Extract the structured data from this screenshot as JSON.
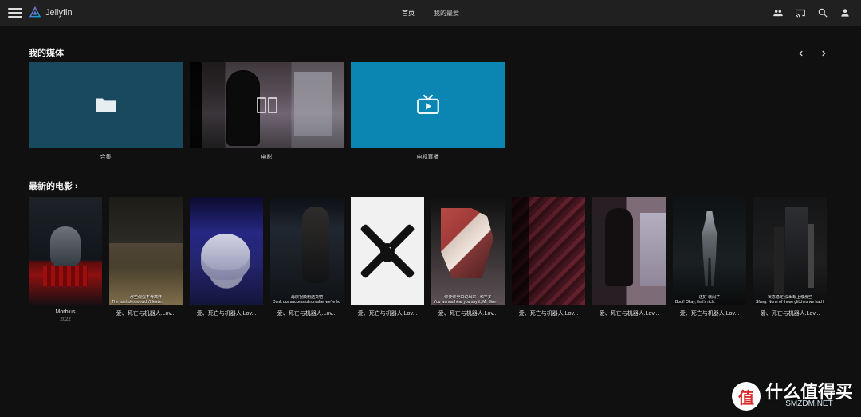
{
  "app": {
    "name": "Jellyfin"
  },
  "nav": {
    "tabs": [
      {
        "label": "首页"
      },
      {
        "label": "我的最爱"
      }
    ]
  },
  "sections": {
    "my_media_title": "我的媒体",
    "latest_movies_title": "最新的电影 ›"
  },
  "libraries": [
    {
      "label": "合集"
    },
    {
      "label": "电影"
    },
    {
      "label": "电视直播"
    }
  ],
  "latest_movies": [
    {
      "title": "Morbius",
      "year": "2022",
      "caption_top": "",
      "caption_bottom": ""
    },
    {
      "title": "爱、死亡与机器人.Lov...",
      "year": "",
      "caption_top": "那些混蛋不肯离开",
      "caption_bottom": "The assholes wouldn't leave."
    },
    {
      "title": "爱、死亡与机器人.Lov...",
      "year": "",
      "caption_top": "",
      "caption_bottom": ""
    },
    {
      "title": "爱、死亡与机器人.Lov...",
      "year": "",
      "caption_top": "再庆祝顺利送货吧",
      "caption_bottom": "Drink our successful run after we're ho"
    },
    {
      "title": "爱、死亡与机器人.Lov...",
      "year": "",
      "caption_top": "",
      "caption_bottom": ""
    },
    {
      "title": "爱、死亡与机器人.Lov...",
      "year": "",
      "caption_top": "你要你卖口说出来 · 和平多",
      "caption_bottom": "You wanna hear you say it, Mr Siren"
    },
    {
      "title": "爱、死亡与机器人.Lov...",
      "year": "",
      "caption_top": "",
      "caption_bottom": ""
    },
    {
      "title": "爱、死亡与机器人.Lov...",
      "year": "",
      "caption_top": "",
      "caption_bottom": ""
    },
    {
      "title": "爱、死亡与机器人.Lov...",
      "year": "",
      "caption_top": "还好 就闹了",
      "caption_bottom": "Boot! Okay, that's rich."
    },
    {
      "title": "爱、死亡与机器人.Lov...",
      "year": "",
      "caption_top": "状态稳定 没出现上级那些",
      "caption_bottom": "Sfang. None of those glitches we had l"
    }
  ],
  "watermark": {
    "badge": "值",
    "text": "什么值得买",
    "overlay": "SMZDM.NET"
  },
  "colors": {
    "background": "#101010",
    "header": "#202020",
    "collection_tile": "#19495f",
    "livetv_tile": "#0b86b3",
    "accent": "#00a4dc"
  }
}
